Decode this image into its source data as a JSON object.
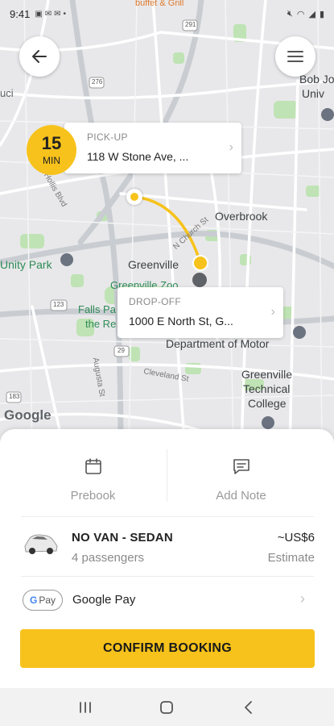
{
  "status_bar": {
    "time": "9:41",
    "left_icons": [
      "image-icon",
      "mail-icon",
      "mail-icon",
      "notification-dot"
    ],
    "right_icons": [
      "mute-icon",
      "wifi-icon",
      "signal-icon",
      "battery-icon"
    ]
  },
  "map": {
    "labels": {
      "overbrook": "Overbrook",
      "greenville": "Greenville",
      "greenville_zoo": "Greenville Zoo",
      "unity_park": "Unity Park",
      "falls_park_1": "Falls Pa",
      "falls_park_2": "the Re",
      "dept_motor": "Department of Motor",
      "gtc_1": "Greenville",
      "gtc_2": "Technical",
      "gtc_3": "College",
      "bob_jones_1": "Bob Jo",
      "bob_jones_2": "Univ",
      "uci": "uci",
      "n_church": "N Church St",
      "cleveland": "Cleveland St",
      "augusta": "Augusta St",
      "hollis": "Hollis Blvd",
      "buffet": "buffet & Grill",
      "road_291": "291",
      "road_276": "276",
      "road_123": "123",
      "road_29": "29",
      "road_183": "183"
    },
    "attribution": "Google",
    "colors": {
      "route": "#f7c21b",
      "park": "#bfe3b4",
      "road": "#ffffff",
      "highway": "#c8ccd1"
    }
  },
  "eta": {
    "value": "15",
    "unit": "MIN"
  },
  "pickup": {
    "kind": "PICK-UP",
    "address": "118 W Stone Ave, ..."
  },
  "dropoff": {
    "kind": "DROP-OFF",
    "address": "1000 E North St, G..."
  },
  "options": {
    "prebook": {
      "label": "Prebook",
      "icon": "calendar-icon"
    },
    "note": {
      "label": "Add Note",
      "icon": "message-icon"
    }
  },
  "vehicle": {
    "name": "NO VAN - SEDAN",
    "passengers": "4 passengers",
    "fare": "~US$6",
    "fare_label": "Estimate"
  },
  "payment": {
    "badge": "Pay",
    "badge_g": "G",
    "method": "Google Pay"
  },
  "confirm": {
    "label": "CONFIRM BOOKING"
  },
  "accent": "#f7c21b"
}
